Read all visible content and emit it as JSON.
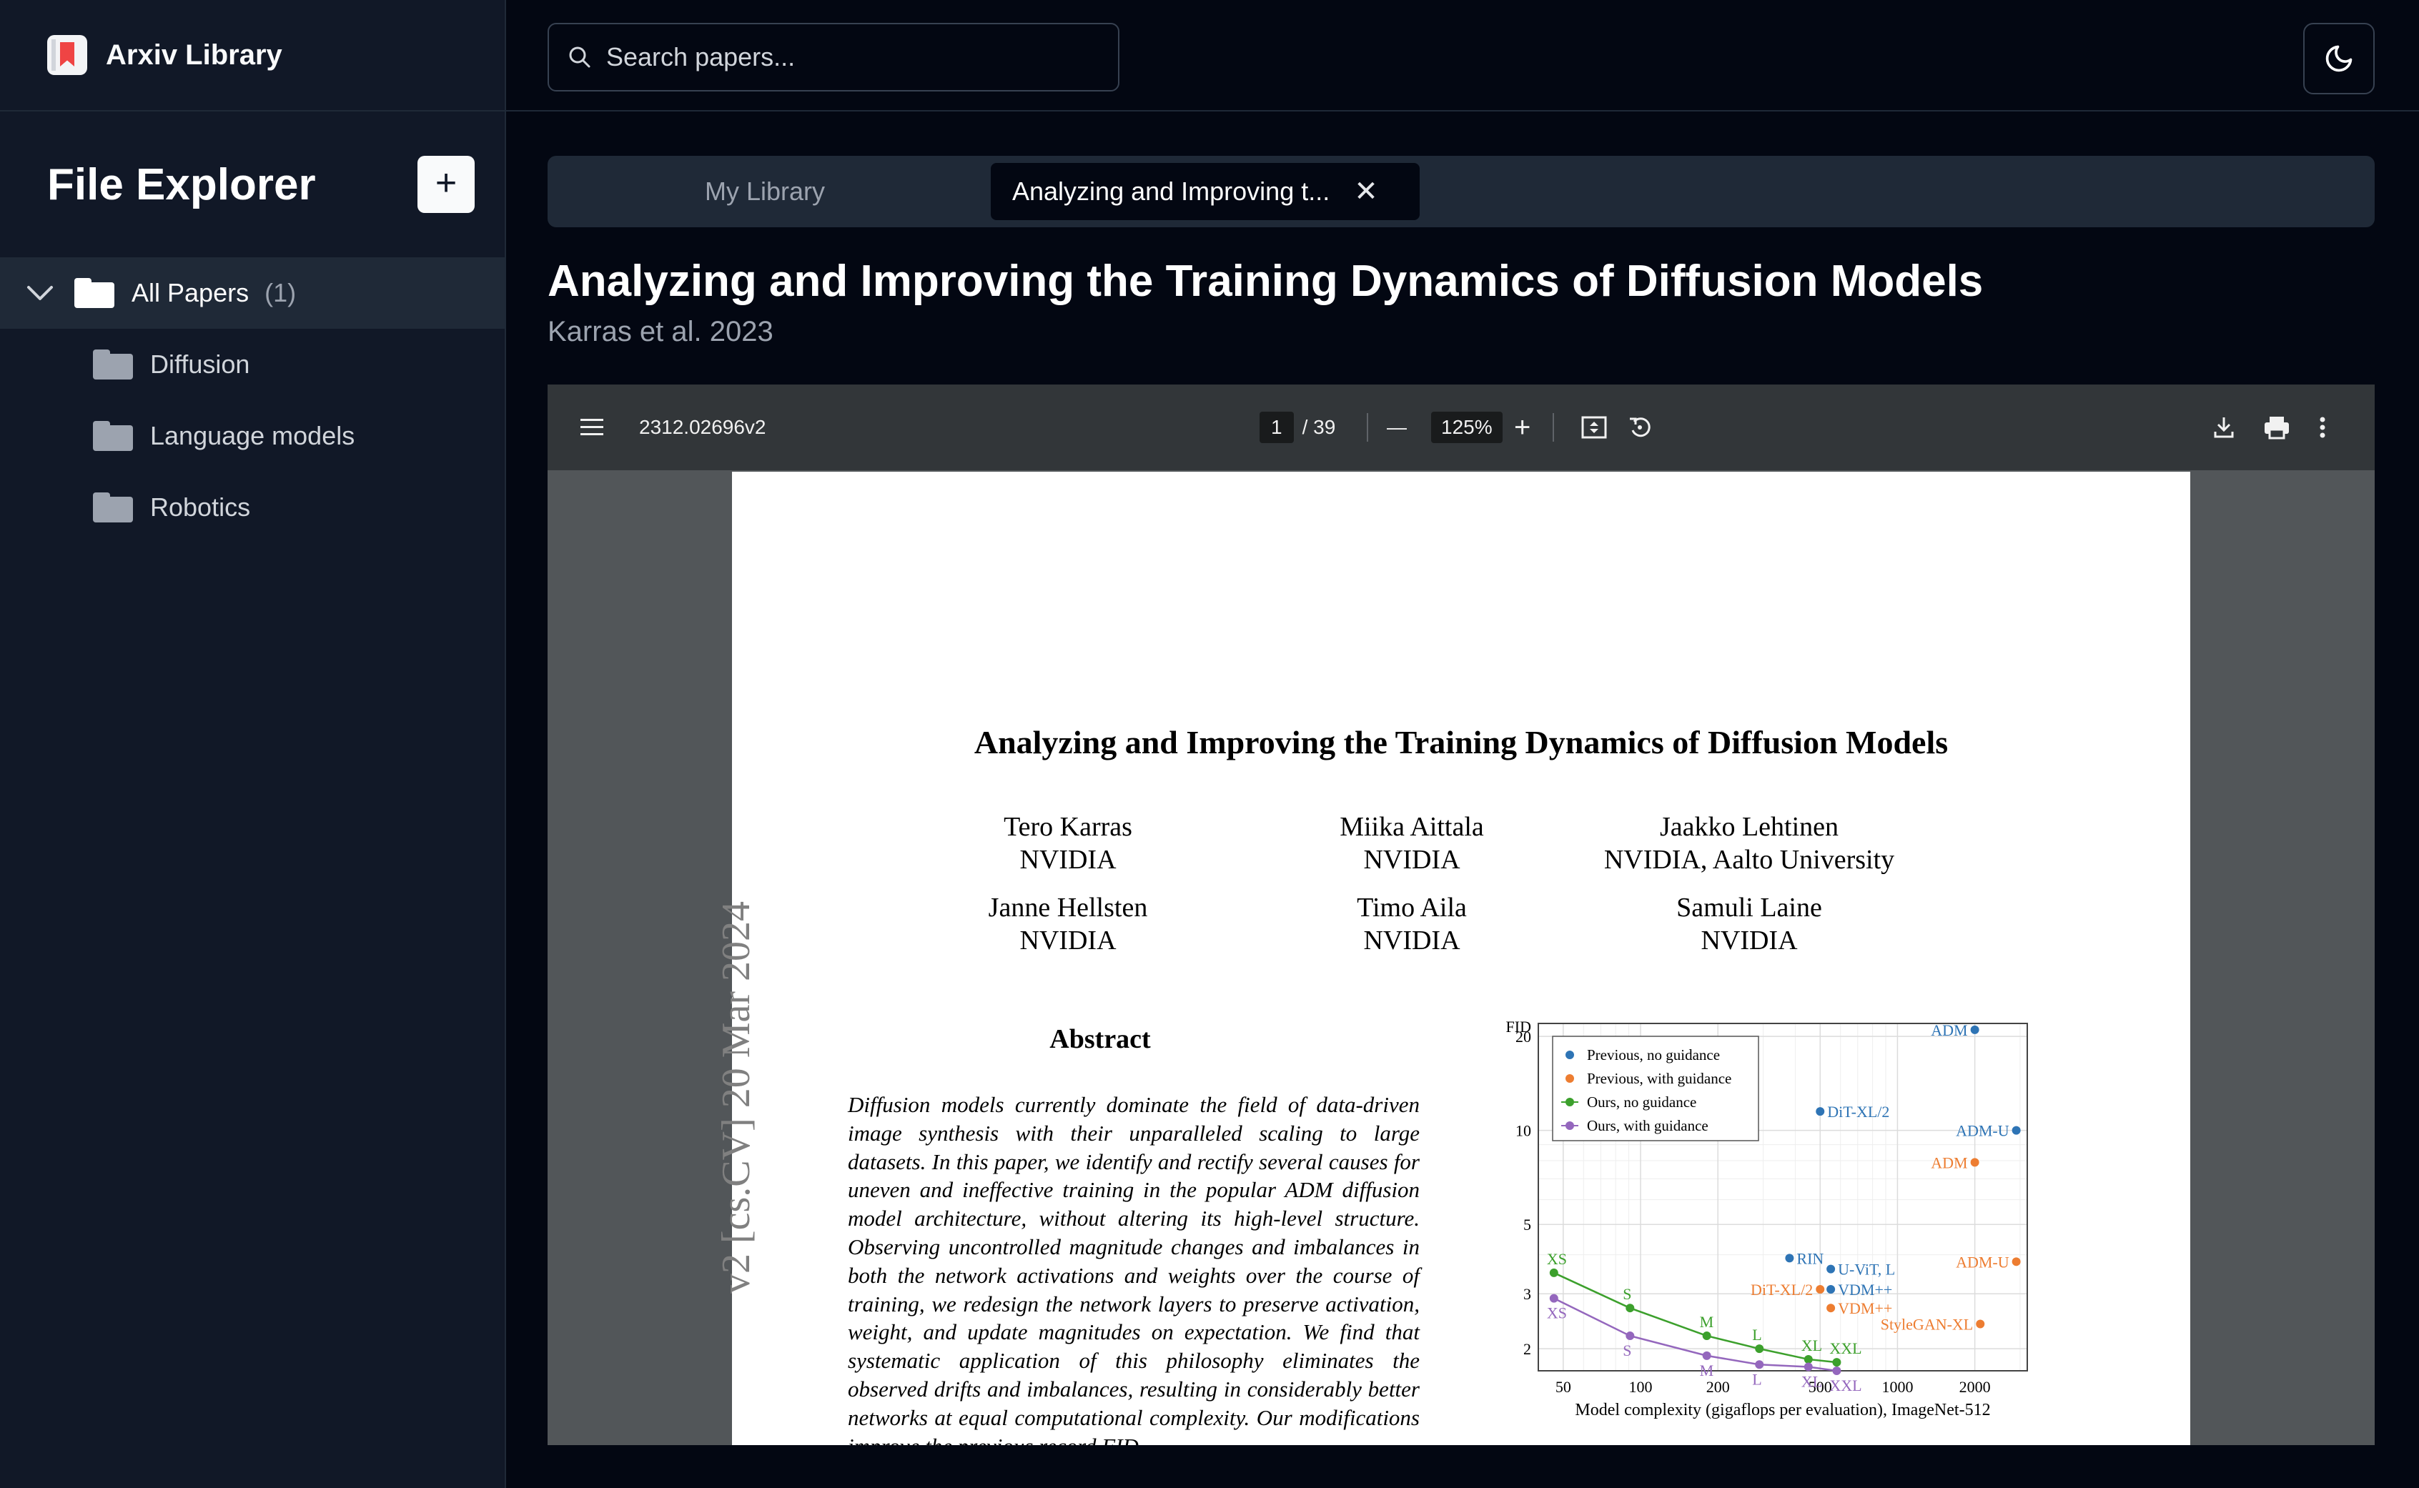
{
  "app": {
    "title": "Arxiv Library"
  },
  "sidebar": {
    "heading": "File Explorer",
    "add_label": "+",
    "root": {
      "label": "All Papers",
      "count": "(1)"
    },
    "folders": [
      {
        "label": "Diffusion"
      },
      {
        "label": "Language models"
      },
      {
        "label": "Robotics"
      }
    ]
  },
  "search": {
    "placeholder": "Search papers..."
  },
  "tabs": {
    "library": "My Library",
    "active": "Analyzing and Improving t...",
    "close": "✕"
  },
  "paper": {
    "title": "Analyzing and Improving the Training Dynamics of Diffusion Models",
    "subtitle": "Karras et al. 2023"
  },
  "viewer": {
    "filename": "2312.02696v2",
    "page_current": "1",
    "page_total": "/ 39",
    "zoom": "125%",
    "minus": "—",
    "plus": "+",
    "pdf": {
      "title": "Analyzing and Improving the Training Dynamics of Diffusion Models",
      "authors": [
        {
          "name": "Tero Karras",
          "aff": "NVIDIA"
        },
        {
          "name": "Miika Aittala",
          "aff": "NVIDIA"
        },
        {
          "name": "Jaakko Lehtinen",
          "aff": "NVIDIA, Aalto University"
        },
        {
          "name": "Janne Hellsten",
          "aff": "NVIDIA"
        },
        {
          "name": "Timo Aila",
          "aff": "NVIDIA"
        },
        {
          "name": "Samuli Laine",
          "aff": "NVIDIA"
        }
      ],
      "side_id": "v2  [cs.CV]  20 Mar 2024",
      "abstract_heading": "Abstract",
      "abstract_text": "Diffusion models currently dominate the field of data-driven image synthesis with their unparalleled scaling to large datasets. In this paper, we identify and rectify several causes for uneven and ineffective training in the popular ADM diffusion model architecture, without altering its high-level structure. Observing uncontrolled magnitude changes and imbalances in both the network activations and weights over the course of training, we redesign the network layers to preserve activation, weight, and update magnitudes on expectation. We find that systematic application of this philosophy eliminates the observed drifts and imbalances, resulting in considerably better networks at equal computational complexity. Our modifications improve the previous record FID"
    }
  },
  "chart_data": {
    "type": "scatter",
    "title": "",
    "xlabel": "Model complexity (gigaflops per evaluation), ImageNet-512",
    "ylabel": "FID",
    "x_scale": "log",
    "y_scale": "log",
    "xlim": [
      40,
      3200
    ],
    "ylim": [
      1.7,
      22
    ],
    "xticks": [
      "50",
      "100",
      "200",
      "500",
      "1000",
      "2000"
    ],
    "yticks": [
      "2",
      "3",
      "5",
      "10",
      "20"
    ],
    "legend_position": "top-left",
    "colors": {
      "prev_no": "#2e74b5",
      "prev_with": "#ed7d31",
      "ours_no": "#3ca02c",
      "ours_with": "#9467bd"
    },
    "series": [
      {
        "name": "Previous, no guidance",
        "color_key": "prev_no",
        "line": false,
        "points": [
          {
            "x": 2000,
            "y": 21,
            "label": "ADM",
            "anchor": "end"
          },
          {
            "x": 500,
            "y": 11.5,
            "label": "DiT-XL/2",
            "anchor": "start"
          },
          {
            "x": 2900,
            "y": 10,
            "label": "ADM-U",
            "anchor": "end"
          },
          {
            "x": 380,
            "y": 3.9,
            "label": "RIN",
            "anchor": "start"
          },
          {
            "x": 550,
            "y": 3.6,
            "label": "U-ViT, L",
            "anchor": "start"
          },
          {
            "x": 550,
            "y": 3.1,
            "label": "VDM++",
            "anchor": "start"
          }
        ]
      },
      {
        "name": "Previous, with guidance",
        "color_key": "prev_with",
        "line": false,
        "points": [
          {
            "x": 2000,
            "y": 7.9,
            "label": "ADM",
            "anchor": "end"
          },
          {
            "x": 2900,
            "y": 3.8,
            "label": "ADM-U",
            "anchor": "end"
          },
          {
            "x": 500,
            "y": 3.1,
            "label": "DiT-XL/2",
            "anchor": "end"
          },
          {
            "x": 550,
            "y": 2.7,
            "label": "VDM++",
            "anchor": "start"
          },
          {
            "x": 2100,
            "y": 2.4,
            "label": "StyleGAN-XL",
            "anchor": "end"
          }
        ]
      },
      {
        "name": "Ours, no guidance",
        "color_key": "ours_no",
        "line": true,
        "points": [
          {
            "x": 46,
            "y": 3.5,
            "label": "XS",
            "anchor": "start"
          },
          {
            "x": 91,
            "y": 2.7,
            "label": "S",
            "anchor": "start"
          },
          {
            "x": 181,
            "y": 2.2,
            "label": "M",
            "anchor": "start"
          },
          {
            "x": 290,
            "y": 2.0,
            "label": "L",
            "anchor": "start"
          },
          {
            "x": 450,
            "y": 1.85,
            "label": "XL",
            "anchor": "start"
          },
          {
            "x": 580,
            "y": 1.81,
            "label": "XXL",
            "anchor": "start"
          }
        ]
      },
      {
        "name": "Ours, with guidance",
        "color_key": "ours_with",
        "line": true,
        "points": [
          {
            "x": 46,
            "y": 2.9,
            "label": "XS",
            "anchor": "start"
          },
          {
            "x": 91,
            "y": 2.2,
            "label": "S",
            "anchor": "start"
          },
          {
            "x": 181,
            "y": 1.9,
            "label": "M",
            "anchor": "start"
          },
          {
            "x": 290,
            "y": 1.78,
            "label": "L",
            "anchor": "start"
          },
          {
            "x": 450,
            "y": 1.75,
            "label": "XL",
            "anchor": "start"
          },
          {
            "x": 580,
            "y": 1.7,
            "label": "XXL",
            "anchor": "start"
          }
        ]
      }
    ]
  }
}
